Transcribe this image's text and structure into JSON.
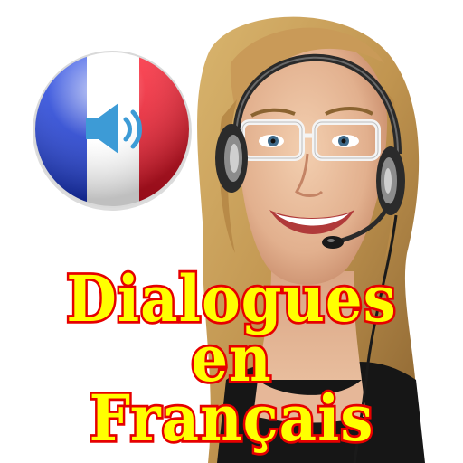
{
  "title": {
    "line1": "Dialogues",
    "line2": "en",
    "line3": "Français"
  },
  "flag": {
    "colors": [
      "#1f3fd1",
      "#ffffff",
      "#e8192c"
    ],
    "icon": "speaker-volume-icon"
  },
  "colors": {
    "title_fill": "#ffff00",
    "title_stroke": "#e60000",
    "speaker": "#3d9bd6"
  }
}
